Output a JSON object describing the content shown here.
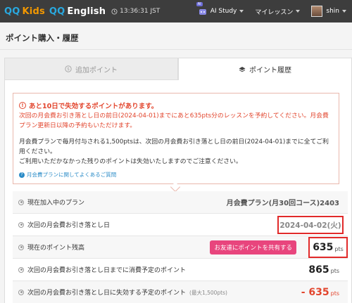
{
  "header": {
    "logo": {
      "qq1": "QQ",
      "kids": "Kids",
      "qq2": "QQ",
      "english": "English"
    },
    "time": "13:36:31 JST",
    "ai_badge": "AI",
    "ai_study": "AI Study",
    "my_lesson": "マイレッスン",
    "user": "shin"
  },
  "page": {
    "title": "ポイント購入・履歴"
  },
  "tabs": [
    {
      "label": "追加ポイント",
      "active": false
    },
    {
      "label": "ポイント履歴",
      "active": true
    }
  ],
  "notice": {
    "headline": "あと10日で失効するポイントがあります。",
    "red_text": "次回の月会費お引き落とし日の前日(2024-04-01)までにあと635pts分のレッスンを予約してください。月会費プラン更新日以降の予約もいただけます。",
    "body_text_1": "月会費プランで毎月付与される1,500ptsは、次回の月会費お引き落とし日の前日(2024-04-01)までに全てご利用ください。",
    "body_text_2": "ご利用いただかなかった残りのポイントは失効いたしますのでご注意ください。",
    "link_text": "月会費プランに関してよくあるご質問"
  },
  "rows": {
    "plan_label": "現在加入中のプラン",
    "plan_value": "月会費プラン(月30回コース)2403",
    "next_date_label": "次回の月会費お引き落とし日",
    "next_date_value": "2024-04-02(火)",
    "balance_label": "現在のポイント残高",
    "share_button": "お友達にポイントを共有する",
    "balance_value": "635",
    "balance_unit": "pts",
    "consume_label": "次回の月会費お引き落とし日までに消費予定のポイント",
    "consume_value": "865",
    "consume_unit": "pts",
    "expire_label": "次回の月会費お引き落とし日に失効する予定のポイント",
    "expire_note": "(最大1,500pts)",
    "expire_value": "- 635",
    "expire_unit": "pts"
  },
  "colors": {
    "accent_red": "#e2452d",
    "share_pink": "#e8457d",
    "highlight_box": "#e12a2a",
    "link_blue": "#2a8bc7"
  }
}
